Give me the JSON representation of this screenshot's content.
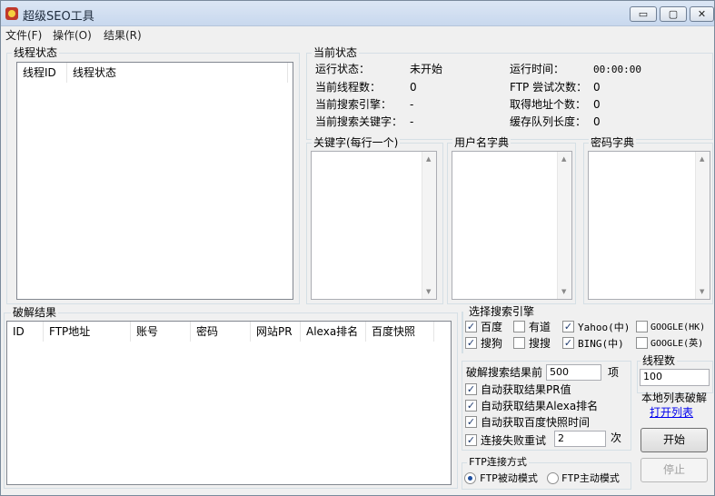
{
  "window": {
    "title": "超级SEO工具",
    "btn_min": "▭",
    "btn_max": "▢",
    "btn_close": "✕"
  },
  "menu": {
    "file": "文件(F)",
    "operate": "操作(O)",
    "result": "结果(R)"
  },
  "threads": {
    "group": "线程状态",
    "col_id": "线程ID",
    "col_status": "线程状态"
  },
  "status": {
    "group": "当前状态",
    "run_state_label": "运行状态：",
    "run_state": "未开始",
    "run_time_label": "运行时间：",
    "run_time": "00:00:00",
    "thread_count_label": "当前线程数：",
    "thread_count": "0",
    "ftp_tries_label": "FTP 尝试次数：",
    "ftp_tries": "0",
    "engine_label": "当前搜索引擎：",
    "engine": "-",
    "addr_count_label": "取得地址个数：",
    "addr_count": "0",
    "keyword_label": "当前搜索关键字：",
    "keyword": "-",
    "queue_label": "缓存队列长度：",
    "queue": "0"
  },
  "dicts": {
    "keywords": "关键字(每行一个)",
    "users": "用户名字典",
    "passwords": "密码字典"
  },
  "results": {
    "group": "破解结果",
    "cols": [
      "ID",
      "FTP地址",
      "账号",
      "密码",
      "网站PR",
      "Alexa排名",
      "百度快照"
    ]
  },
  "engines": {
    "group": "选择搜索引擎",
    "baidu": "百度",
    "youdao": "有道",
    "yahoo": "Yahoo(中)",
    "google_hk": "GOOGLE(HK)",
    "sogou": "搜狗",
    "soso": "搜搜",
    "bing": "BING(中)",
    "google_en": "GOOGLE(英)"
  },
  "options": {
    "top_label": "破解搜索结果前",
    "top_value": "500",
    "top_unit": "项",
    "pr": "自动获取结果PR值",
    "alexa": "自动获取结果Alexa排名",
    "baidu_snap": "自动获取百度快照时间",
    "retry": "连接失败重试",
    "retry_value": "2",
    "retry_unit": "次"
  },
  "ftp": {
    "group": "FTP连接方式",
    "passive": "FTP被动模式",
    "active": "FTP主动模式"
  },
  "thread_num": {
    "group": "线程数",
    "value": "100"
  },
  "local": {
    "label": "本地列表破解",
    "link": "打开列表"
  },
  "buttons": {
    "start": "开始",
    "stop": "停止"
  },
  "scroll": {
    "up": "▲",
    "down": "▼"
  },
  "check_mark": "✓"
}
